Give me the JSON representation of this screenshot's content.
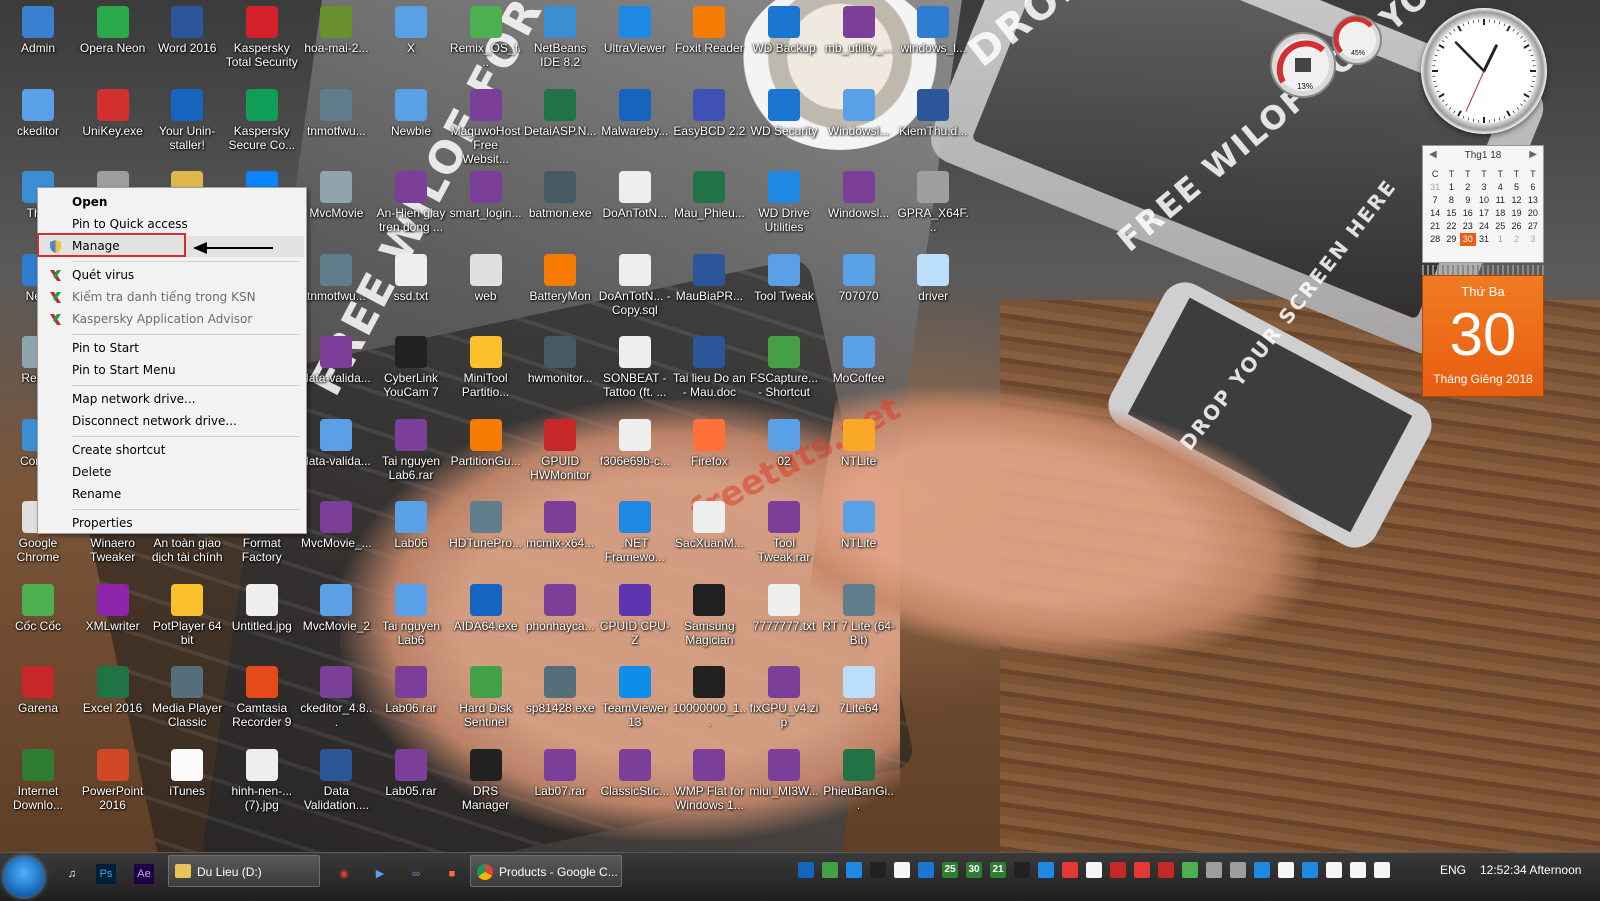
{
  "wallpaper": {
    "slogans": [
      "DROP YOUR SCREEN HERE",
      "FREE WILOF FOR YOU",
      "DROP YOUR SCREEN HERE",
      "FREE WILOF FOR YOU"
    ],
    "watermark": "freetuts.net"
  },
  "desktop_icons": [
    {
      "label": "Admin",
      "icon": "user-folder-icon",
      "color": "#3b7fd1"
    },
    {
      "label": "Opera Neon",
      "icon": "opera-icon",
      "color": "#2aa84a"
    },
    {
      "label": "Word 2016",
      "icon": "word-icon",
      "color": "#2b579a"
    },
    {
      "label": "Kaspersky Total Security",
      "icon": "kaspersky-icon",
      "color": "#d4202b"
    },
    {
      "label": "hoa-mai-2...",
      "icon": "image-file-icon",
      "color": "#6a8f2f"
    },
    {
      "label": "X",
      "icon": "folder-icon",
      "color": "#5aa0e6"
    },
    {
      "label": "Remix_OS_f...",
      "icon": "remix-icon",
      "color": "#4caf50"
    },
    {
      "label": "NetBeans IDE 8.2",
      "icon": "netbeans-icon",
      "color": "#3a8ed4"
    },
    {
      "label": "UltraViewer",
      "icon": "ultraviewer-icon",
      "color": "#1e88e5"
    },
    {
      "label": "Foxit Reader",
      "icon": "foxit-icon",
      "color": "#f57c00"
    },
    {
      "label": "WD Backup",
      "icon": "wd-backup-icon",
      "color": "#1976d2"
    },
    {
      "label": "mb_utility_...",
      "icon": "winrar-icon",
      "color": "#7b3f9a"
    },
    {
      "label": "windows_l...",
      "icon": "windows-icon",
      "color": "#2f7cd3"
    },
    {
      "label": "ckeditor",
      "icon": "zip-folder-icon",
      "color": "#5aa0e6"
    },
    {
      "label": "UniKey.exe",
      "icon": "unikey-icon",
      "color": "#d32f2f"
    },
    {
      "label": "Your Unin-staller!",
      "icon": "uninstaller-icon",
      "color": "#1565c0"
    },
    {
      "label": "Kaspersky Secure Co...",
      "icon": "kaspersky-secure-icon",
      "color": "#0f9d58"
    },
    {
      "label": "tnmotfwu...",
      "icon": "window-icon",
      "color": "#607d8b"
    },
    {
      "label": "Newbie",
      "icon": "folder-icon",
      "color": "#5aa0e6"
    },
    {
      "label": "MaguwoHost Free Websit...",
      "icon": "winrar-icon",
      "color": "#7b3f9a"
    },
    {
      "label": "DetaiASP.N...",
      "icon": "excel-icon",
      "color": "#217346"
    },
    {
      "label": "Malwareby...",
      "icon": "malwarebytes-icon",
      "color": "#1565c0"
    },
    {
      "label": "EasyBCD 2.2",
      "icon": "easybcd-icon",
      "color": "#3f51b5"
    },
    {
      "label": "WD Security",
      "icon": "wd-security-icon",
      "color": "#1976d2"
    },
    {
      "label": "Windowsl...",
      "icon": "zip-folder-icon",
      "color": "#5aa0e6"
    },
    {
      "label": "KiemThu.d...",
      "icon": "word-icon",
      "color": "#2b579a"
    },
    {
      "label": "This",
      "icon": "computer-icon",
      "color": "#3a8ed4"
    },
    {
      "label": "",
      "icon": "disc-icon",
      "color": "#9e9e9e"
    },
    {
      "label": "",
      "icon": "folder-icon",
      "color": "#e0b84a"
    },
    {
      "label": "",
      "icon": "zalo-icon",
      "color": "#0a84ff"
    },
    {
      "label": "MvcMovie",
      "icon": "file-icon",
      "color": "#90a4ae"
    },
    {
      "label": "An-Hien giay tren dong ...",
      "icon": "winrar-icon",
      "color": "#7b3f9a"
    },
    {
      "label": "smart_login...",
      "icon": "winrar-icon",
      "color": "#7b3f9a"
    },
    {
      "label": "batmon.exe",
      "icon": "batmon-icon",
      "color": "#455a64"
    },
    {
      "label": "DoAnTotN...",
      "icon": "text-file-icon",
      "color": "#eeeeee"
    },
    {
      "label": "Mau_Phieu...",
      "icon": "excel-icon",
      "color": "#217346"
    },
    {
      "label": "WD Drive Utilities",
      "icon": "wd-drive-icon",
      "color": "#1e88e5"
    },
    {
      "label": "Windowsl...",
      "icon": "winrar-icon",
      "color": "#7b3f9a"
    },
    {
      "label": "GPRA_X64F...",
      "icon": "disc-icon",
      "color": "#9e9e9e"
    },
    {
      "label": "Netv",
      "icon": "network-icon",
      "color": "#2f7cd3"
    },
    {
      "label": "tnmotfwu...",
      "icon": "window-icon",
      "color": "#607d8b"
    },
    {
      "label": "ssd.txt",
      "icon": "text-file-icon",
      "color": "#eeeeee"
    },
    {
      "label": "web",
      "icon": "chrome-icon",
      "color": "#e0e0e0"
    },
    {
      "label": "BatteryMon",
      "icon": "batterymon-icon",
      "color": "#f57c00"
    },
    {
      "label": "DoAnTotN... - Copy.sql",
      "icon": "sql-file-icon",
      "color": "#eeeeee"
    },
    {
      "label": "MauBiaPR...",
      "icon": "word-icon",
      "color": "#2b579a"
    },
    {
      "label": "Tool Tweak",
      "icon": "zip-folder-icon",
      "color": "#5aa0e6"
    },
    {
      "label": "707070",
      "icon": "zip-folder-icon",
      "color": "#5aa0e6"
    },
    {
      "label": "driver",
      "icon": "file-icon",
      "color": "#bbdefb"
    },
    {
      "label": "Recyc",
      "icon": "recycle-bin-icon",
      "color": "#90a4ae"
    },
    {
      "label": "data-valida...",
      "icon": "winrar-icon",
      "color": "#7b3f9a"
    },
    {
      "label": "CyberLink YouCam 7",
      "icon": "youcam-icon",
      "color": "#212121"
    },
    {
      "label": "MiniTool Partitio...",
      "icon": "minitool-icon",
      "color": "#fbc02d"
    },
    {
      "label": "hwmonitor...",
      "icon": "hwmonitor-icon",
      "color": "#455a64"
    },
    {
      "label": "SONBEAT - Tattoo (ft. ...",
      "icon": "mp3-file-icon",
      "color": "#eeeeee"
    },
    {
      "label": "Tai lieu Do an - Mau.doc",
      "icon": "word-icon",
      "color": "#2b579a"
    },
    {
      "label": "FSCapture... - Shortcut",
      "icon": "fscapture-icon",
      "color": "#43a047"
    },
    {
      "label": "MoCoffee",
      "icon": "zip-folder-icon",
      "color": "#5aa0e6"
    },
    {
      "label": "Contro",
      "icon": "control-panel-icon",
      "color": "#3a8ed4"
    },
    {
      "label": "data-valida...",
      "icon": "zip-folder-icon",
      "color": "#5aa0e6"
    },
    {
      "label": "Tai nguyen Lab6.rar",
      "icon": "winrar-icon",
      "color": "#7b3f9a"
    },
    {
      "label": "PartitionGu...",
      "icon": "partitionguru-icon",
      "color": "#f57c00"
    },
    {
      "label": "GPUID HWMonitor",
      "icon": "gpuid-icon",
      "color": "#c62828"
    },
    {
      "label": "f306e69b-c...",
      "icon": "image-file-icon",
      "color": "#eeeeee"
    },
    {
      "label": "Firefox",
      "icon": "firefox-icon",
      "color": "#ff7139"
    },
    {
      "label": "02",
      "icon": "zip-folder-icon",
      "color": "#5aa0e6"
    },
    {
      "label": "NTLite",
      "icon": "ntlite-icon",
      "color": "#f9a825"
    },
    {
      "label": "Google Chrome",
      "icon": "chrome-icon",
      "color": "#e0e0e0"
    },
    {
      "label": "Winaero Tweaker",
      "icon": "winaero-icon",
      "color": "#546e7a"
    },
    {
      "label": "An toàn giao dịch tài chính",
      "icon": "kaspersky-icon",
      "color": "#2e7d32"
    },
    {
      "label": "Format Factory",
      "icon": "format-factory-icon",
      "color": "#1565c0"
    },
    {
      "label": "MvcMovie_...",
      "icon": "winrar-icon",
      "color": "#7b3f9a"
    },
    {
      "label": "Lab06",
      "icon": "zip-folder-icon",
      "color": "#5aa0e6"
    },
    {
      "label": "HDTunePro...",
      "icon": "hdtune-icon",
      "color": "#607d8b"
    },
    {
      "label": "mcmix-x64...",
      "icon": "winrar-icon",
      "color": "#7b3f9a"
    },
    {
      "label": ".NET Framewo...",
      "icon": "dotnet-icon",
      "color": "#1e88e5"
    },
    {
      "label": "SacXuanM...",
      "icon": "text-file-icon",
      "color": "#eeeeee"
    },
    {
      "label": "Tool Tweak.rar",
      "icon": "winrar-icon",
      "color": "#7b3f9a"
    },
    {
      "label": "NTLite",
      "icon": "zip-folder-icon",
      "color": "#5aa0e6"
    },
    {
      "label": "Cốc Cốc",
      "icon": "coccoc-icon",
      "color": "#4caf50"
    },
    {
      "label": "XMLwriter",
      "icon": "xmlwriter-icon",
      "color": "#8e24aa"
    },
    {
      "label": "PotPlayer 64 bit",
      "icon": "potplayer-icon",
      "color": "#fbc02d"
    },
    {
      "label": "Untitled.jpg",
      "icon": "image-file-icon",
      "color": "#eeeeee"
    },
    {
      "label": "MvcMovie_2",
      "icon": "zip-folder-icon",
      "color": "#5aa0e6"
    },
    {
      "label": "Tai nguyen Lab6",
      "icon": "zip-folder-icon",
      "color": "#5aa0e6"
    },
    {
      "label": "AIDA64.exe",
      "icon": "aida64-icon",
      "color": "#1565c0"
    },
    {
      "label": "phonhayca...",
      "icon": "winrar-icon",
      "color": "#7b3f9a"
    },
    {
      "label": "CPUID CPU-Z",
      "icon": "cpuz-icon",
      "color": "#5e35b1"
    },
    {
      "label": "Samsung Magician",
      "icon": "samsung-ssd-icon",
      "color": "#212121"
    },
    {
      "label": "7777777.txt",
      "icon": "text-file-icon",
      "color": "#eeeeee"
    },
    {
      "label": "RT 7 Lite (64-Bit)",
      "icon": "rt7lite-icon",
      "color": "#607d8b"
    },
    {
      "label": "Garena",
      "icon": "garena-icon",
      "color": "#c62828"
    },
    {
      "label": "Excel 2016",
      "icon": "excel-icon",
      "color": "#217346"
    },
    {
      "label": "Media Player Classic",
      "icon": "mpc-icon",
      "color": "#546e7a"
    },
    {
      "label": "Camtasia Recorder 9",
      "icon": "camtasia-icon",
      "color": "#e64a19"
    },
    {
      "label": "ckeditor_4.8...",
      "icon": "winrar-icon",
      "color": "#7b3f9a"
    },
    {
      "label": "Lab06.rar",
      "icon": "winrar-icon",
      "color": "#7b3f9a"
    },
    {
      "label": "Hard Disk Sentinel",
      "icon": "hdsentinel-icon",
      "color": "#43a047"
    },
    {
      "label": "sp81428.exe",
      "icon": "installer-icon",
      "color": "#546e7a"
    },
    {
      "label": "TeamViewer 13",
      "icon": "teamviewer-icon",
      "color": "#0e8ee9"
    },
    {
      "label": "10000000_1...",
      "icon": "video-file-icon",
      "color": "#212121"
    },
    {
      "label": "fixCPU_v4.zip",
      "icon": "winrar-icon",
      "color": "#7b3f9a"
    },
    {
      "label": "7Lite64",
      "icon": "file-icon",
      "color": "#bbdefb"
    },
    {
      "label": "Internet Downlo...",
      "icon": "idm-icon",
      "color": "#2e7d32"
    },
    {
      "label": "PowerPoint 2016",
      "icon": "powerpoint-icon",
      "color": "#d24726"
    },
    {
      "label": "iTunes",
      "icon": "itunes-icon",
      "color": "#fafafa"
    },
    {
      "label": "hinh-nen-... (7).jpg",
      "icon": "image-file-icon",
      "color": "#eeeeee"
    },
    {
      "label": "Data Validation....",
      "icon": "word-icon",
      "color": "#2b579a"
    },
    {
      "label": "Lab05.rar",
      "icon": "winrar-icon",
      "color": "#7b3f9a"
    },
    {
      "label": "DRS Manager",
      "icon": "drs-icon",
      "color": "#212121"
    },
    {
      "label": "Lab07.rar",
      "icon": "winrar-icon",
      "color": "#7b3f9a"
    },
    {
      "label": "ClassicStic...",
      "icon": "winrar-icon",
      "color": "#7b3f9a"
    },
    {
      "label": "WMP Flat for Windows 1...",
      "icon": "winrar-icon",
      "color": "#7b3f9a"
    },
    {
      "label": "miui_MI3W...",
      "icon": "winrar-icon",
      "color": "#7b3f9a"
    },
    {
      "label": "PhieuBanGi...",
      "icon": "excel-icon",
      "color": "#217346"
    }
  ],
  "context_menu": {
    "items": [
      {
        "label": "Open",
        "style": "bold"
      },
      {
        "label": "Pin to Quick access",
        "style": "normal"
      },
      {
        "label": "Manage",
        "style": "hover",
        "icon": "shield-icon"
      },
      {
        "sep": true
      },
      {
        "label": "Quét virus",
        "style": "normal",
        "icon": "kaspersky-icon"
      },
      {
        "label": "Kiểm tra danh tiếng trong KSN",
        "style": "dim",
        "icon": "kaspersky-icon"
      },
      {
        "label": "Kaspersky Application Advisor",
        "style": "dim",
        "icon": "kaspersky-icon"
      },
      {
        "sep": true
      },
      {
        "label": "Pin to Start",
        "style": "normal"
      },
      {
        "label": "Pin to Start Menu",
        "style": "normal"
      },
      {
        "sep": true
      },
      {
        "label": "Map network drive...",
        "style": "normal"
      },
      {
        "label": "Disconnect network drive...",
        "style": "normal"
      },
      {
        "sep": true
      },
      {
        "label": "Create shortcut",
        "style": "normal"
      },
      {
        "label": "Delete",
        "style": "normal"
      },
      {
        "label": "Rename",
        "style": "normal"
      },
      {
        "sep": true
      },
      {
        "label": "Properties",
        "style": "normal"
      }
    ],
    "highlight_color": "#d92d2d"
  },
  "gadgets": {
    "meters": {
      "cpu": "13%",
      "ram": "45%"
    },
    "clock": {
      "hour": 12,
      "minute": 52,
      "second": 34
    },
    "calendar": {
      "month_label": "Thg1 18",
      "weekday_headers": [
        "C",
        "T",
        "T",
        "T",
        "T",
        "T",
        "T"
      ],
      "weeks": [
        [
          "31",
          "1",
          "2",
          "3",
          "4",
          "5",
          "6"
        ],
        [
          "7",
          "8",
          "9",
          "10",
          "11",
          "12",
          "13"
        ],
        [
          "14",
          "15",
          "16",
          "17",
          "18",
          "19",
          "20"
        ],
        [
          "21",
          "22",
          "23",
          "24",
          "25",
          "26",
          "27"
        ],
        [
          "28",
          "29",
          "30",
          "31",
          "1",
          "2",
          "3"
        ]
      ],
      "today": "30",
      "day_of_week": "Thứ Ba",
      "big_day": "30",
      "month_year": "Tháng Giêng 2018"
    }
  },
  "taskbar": {
    "tasks": [
      {
        "label": "Du Lieu (D:)",
        "icon": "explorer-icon"
      },
      {
        "label": "Products - Google C...",
        "icon": "chrome-icon"
      }
    ],
    "pinned": [
      "itunes-icon",
      "photoshop-icon",
      "after-effects-icon"
    ],
    "pinned_labels": [
      "Ps",
      "Ae"
    ],
    "tray_badges": [
      "25",
      "30",
      "21"
    ],
    "language": "ENG",
    "time": "12:52:34 Afternoon"
  }
}
